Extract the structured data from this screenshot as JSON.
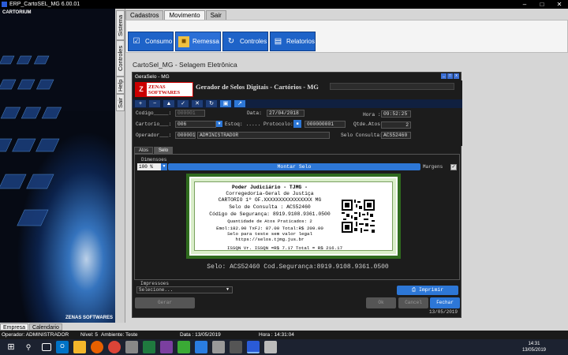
{
  "window": {
    "title": "ERP_CartoSEL_MG 6.00.01",
    "controls": [
      "–",
      "□",
      "✕"
    ]
  },
  "left_panel": {
    "brand": "CARTORIUM",
    "footer": "ZENAS SOFTWARES"
  },
  "vertical_tabs": [
    "Sistema",
    "Controles",
    "Help",
    "Sair"
  ],
  "top_tabs": [
    {
      "label": "Cadastros"
    },
    {
      "label": "Movimento"
    },
    {
      "label": "Sair"
    }
  ],
  "ribbon": [
    {
      "label": "Consumo",
      "icon": "checklist-icon"
    },
    {
      "label": "Remessa",
      "icon": "folder-icon"
    },
    {
      "label": "Controles",
      "icon": "refresh-icon"
    },
    {
      "label": "Relatorios",
      "icon": "report-icon"
    }
  ],
  "subtitle": "CartoSel_MG - Selagem Eletrônica",
  "dialog": {
    "title": "GeraSelo - MG",
    "controls": [
      "_",
      "□",
      "x"
    ],
    "logo_line1": "ZENAS",
    "logo_line2": "SOFTWARES",
    "logo_mark": "Z",
    "header_title": "Gerador de Selos Digitais - Cartórios - MG",
    "tool_icons": [
      "+",
      "−",
      "▲",
      "✓",
      "✕",
      "↻",
      "▣",
      "↗"
    ],
    "form": {
      "codigo_label": "Codigo_____:",
      "codigo_value": "000001",
      "data_label": "Data:",
      "data_value": "27/04/2018",
      "hora_label": "Hora :",
      "hora_value": "09:52:25",
      "cartorio_label": "Cartorio___:",
      "cartorio_value": "006",
      "estoq_label": "Estoq: .....",
      "protocolo_label": "Protocolo:",
      "protocolo_value": "000000001",
      "qtde_label": "Qtde.Atos:",
      "qtde_value": "2",
      "operador_label": "Operador___:",
      "operador_code": "000001",
      "operador_name": "ADMINISTRADOR",
      "selo_consulta_label": "Selo Consulta:",
      "selo_consulta_value": "ACS52460"
    },
    "subtabs": [
      {
        "label": "Atos"
      },
      {
        "label": "Selo"
      }
    ],
    "dimensoes_label": "Dimensoes",
    "zoom_value": "100 %",
    "montar_label": "Montar Selo",
    "margens_label": "Margens",
    "margens_checked": "✓",
    "certificate": {
      "lines": [
        "Poder Judiciário - TJMG -",
        "Corregedoria-Geral de Justiça",
        "CARTORIO 1º OF.XXXXXXXXXXXXXXXX MG",
        "Selo de Consulta : ACS52460",
        "Código de Segurança: 8919.9108.9361.0500",
        "Quantidade de Atos Praticados: 2",
        "Emol:182.00 TxFJ: 87.00 Total:R$ 209.00",
        "Selo para teste sem valor legal",
        "https://selos.tjmg.jus.br",
        "ISSQN Vr. ISSQN =R$ 7.17 Total = R$ 216.17"
      ]
    },
    "selo_info": "Selo: ACS52460 Cod.Segurança:8919.9108.9361.0500",
    "impressoes_label": "Impressoes",
    "impressoes_select": "Selecione...",
    "imprimir_label": "Imprimir",
    "buttons": {
      "gerar": "Gerar",
      "ok": "Ok",
      "cancel": "Cancel",
      "fechar": "Fechar"
    },
    "date": "13/05/2019"
  },
  "bottom_tabs": [
    {
      "label": "Empresa"
    },
    {
      "label": "Calendario"
    }
  ],
  "statusbar": {
    "operador": "Operador: ADMINISTRADOR",
    "nivel": "Nível: 5",
    "ambiente": "Ambiente: Teste",
    "data": "Data : 13/05/2019",
    "hora": "Hora : 14:31:04"
  },
  "taskbar": {
    "time": "14:31",
    "date": "13/05/2019"
  }
}
